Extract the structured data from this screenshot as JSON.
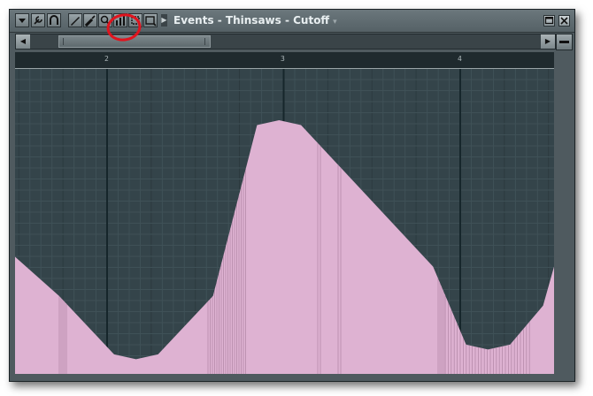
{
  "titlebar": {
    "title": "Events - Thinsaws - Cutoff",
    "caret": "▾"
  },
  "toolbar": {
    "icons": [
      "menu-arrow-icon",
      "wrench-icon",
      "magnet-icon",
      "pencil-icon",
      "paintbrush-icon",
      "zoom-icon",
      "bars-icon",
      "select-icon",
      "playback-icon"
    ]
  },
  "window_buttons": {
    "restore": "□",
    "close": "×"
  },
  "scrollbar": {
    "left_arrow": "◀",
    "right_arrow": "▶"
  },
  "ruler": {
    "bars": [
      "2",
      "3",
      "4"
    ]
  },
  "colors": {
    "envelope_fill": "#deb2d2",
    "grid_background": "#34444a",
    "annotation_circle": "#e0141e"
  },
  "chart_data": {
    "type": "area",
    "description_level": "automation envelope",
    "points": [
      [
        0,
        0.24
      ],
      [
        4,
        0.16
      ],
      [
        9,
        0.04
      ],
      [
        11,
        0.03
      ],
      [
        13,
        0.04
      ],
      [
        18,
        0.16
      ],
      [
        22,
        0.51
      ],
      [
        24,
        0.52
      ],
      [
        26,
        0.51
      ],
      [
        38,
        0.22
      ],
      [
        41,
        0.06
      ],
      [
        43,
        0.05
      ],
      [
        45,
        0.06
      ],
      [
        48,
        0.14
      ],
      [
        49,
        0.22
      ]
    ]
  }
}
